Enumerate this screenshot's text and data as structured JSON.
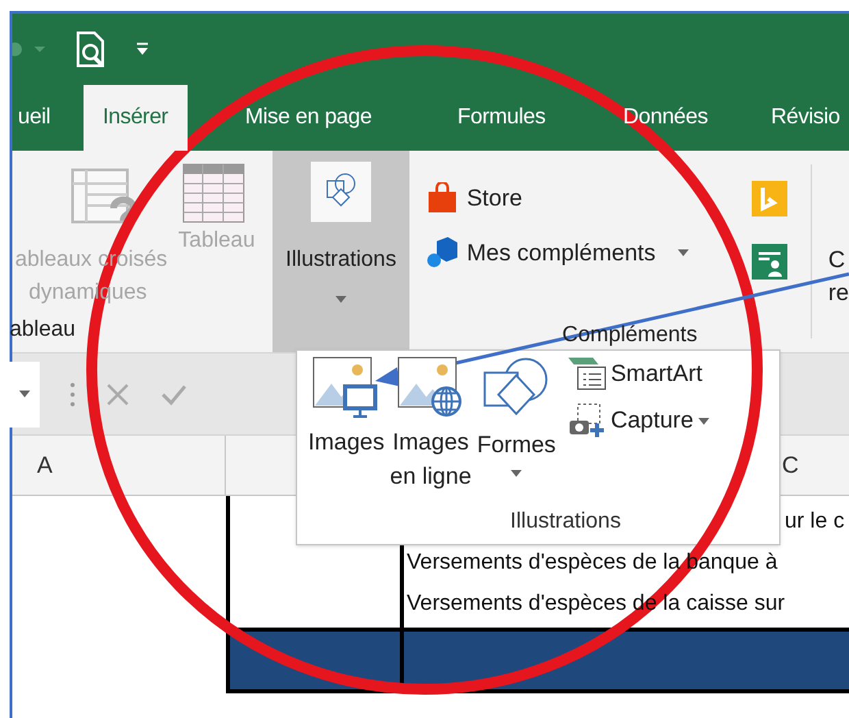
{
  "tabs": [
    {
      "label": "ueil",
      "selected": false
    },
    {
      "label": "Insérer",
      "selected": true
    },
    {
      "label": "Mise en page",
      "selected": false
    },
    {
      "label": "Formules",
      "selected": false
    },
    {
      "label": "Données",
      "selected": false
    },
    {
      "label": "Révisio",
      "selected": false
    }
  ],
  "ribbon": {
    "tables_group": {
      "label": "ableau",
      "buttons": [
        {
          "kind": "pivot",
          "lines": [
            "ableaux croisés",
            "dynamiques"
          ],
          "disabled": true
        },
        {
          "kind": "table",
          "lines": [
            "Tableau"
          ],
          "disabled": true
        }
      ]
    },
    "illustrations_button": {
      "label": "Illustrations",
      "expanded": true
    },
    "addins_group": {
      "label": "Compléments",
      "buttons": [
        {
          "kind": "store",
          "label": "Store",
          "dropdown": false
        },
        {
          "kind": "addins",
          "label": "Mes compléments",
          "dropdown": true
        }
      ]
    },
    "cut_group": {
      "lines": [
        "C",
        "re"
      ]
    }
  },
  "columns": [
    {
      "label": "A"
    },
    {
      "label": "C"
    }
  ],
  "cells": [
    "ur le c",
    "Versements d'espèces de la banque à",
    "Versements d'espèces de la caisse sur"
  ],
  "illustrations_menu": {
    "items": [
      {
        "kind": "pictures",
        "lines": [
          "Images"
        ],
        "dropdown": false
      },
      {
        "kind": "online",
        "lines": [
          "Images",
          "en ligne"
        ],
        "dropdown": false
      },
      {
        "kind": "shapes",
        "lines": [
          "Formes"
        ],
        "dropdown": true
      }
    ],
    "side_items": [
      {
        "kind": "smartart",
        "label": "SmartArt",
        "dropdown": false
      },
      {
        "kind": "capture",
        "label": "Capture",
        "dropdown": true
      }
    ],
    "label": "Illustrations"
  }
}
